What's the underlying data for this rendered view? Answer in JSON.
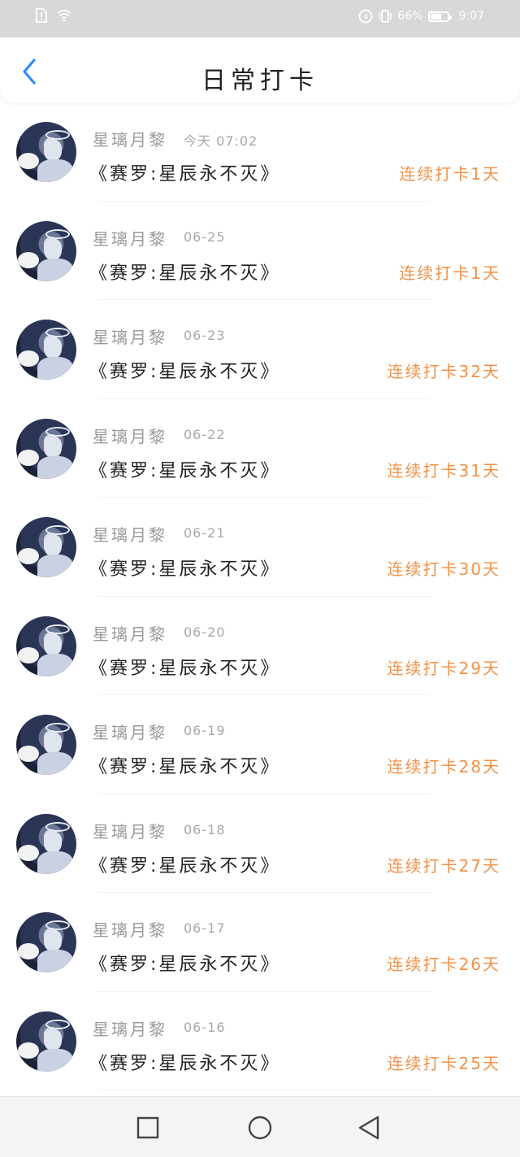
{
  "status_bar": {
    "battery_percent": "66%",
    "time": "9:07"
  },
  "header": {
    "title": "日常打卡"
  },
  "entries": [
    {
      "user": "星璃月黎",
      "date": "今天 07:02",
      "book": "《赛罗:星辰永不灭》",
      "streak": "连续打卡1天"
    },
    {
      "user": "星璃月黎",
      "date": "06-25",
      "book": "《赛罗:星辰永不灭》",
      "streak": "连续打卡1天"
    },
    {
      "user": "星璃月黎",
      "date": "06-23",
      "book": "《赛罗:星辰永不灭》",
      "streak": "连续打卡32天"
    },
    {
      "user": "星璃月黎",
      "date": "06-22",
      "book": "《赛罗:星辰永不灭》",
      "streak": "连续打卡31天"
    },
    {
      "user": "星璃月黎",
      "date": "06-21",
      "book": "《赛罗:星辰永不灭》",
      "streak": "连续打卡30天"
    },
    {
      "user": "星璃月黎",
      "date": "06-20",
      "book": "《赛罗:星辰永不灭》",
      "streak": "连续打卡29天"
    },
    {
      "user": "星璃月黎",
      "date": "06-19",
      "book": "《赛罗:星辰永不灭》",
      "streak": "连续打卡28天"
    },
    {
      "user": "星璃月黎",
      "date": "06-18",
      "book": "《赛罗:星辰永不灭》",
      "streak": "连续打卡27天"
    },
    {
      "user": "星璃月黎",
      "date": "06-17",
      "book": "《赛罗:星辰永不灭》",
      "streak": "连续打卡26天"
    },
    {
      "user": "星璃月黎",
      "date": "06-16",
      "book": "《赛罗:星辰永不灭》",
      "streak": "连续打卡25天"
    }
  ],
  "nav_buttons": {
    "recent": "square-icon",
    "home": "circle-icon",
    "back": "triangle-back-icon"
  },
  "colors": {
    "accent_blue": "#2f8cf0",
    "streak_orange": "#f0924a",
    "status_bar_bg": "#d8d8d8"
  }
}
